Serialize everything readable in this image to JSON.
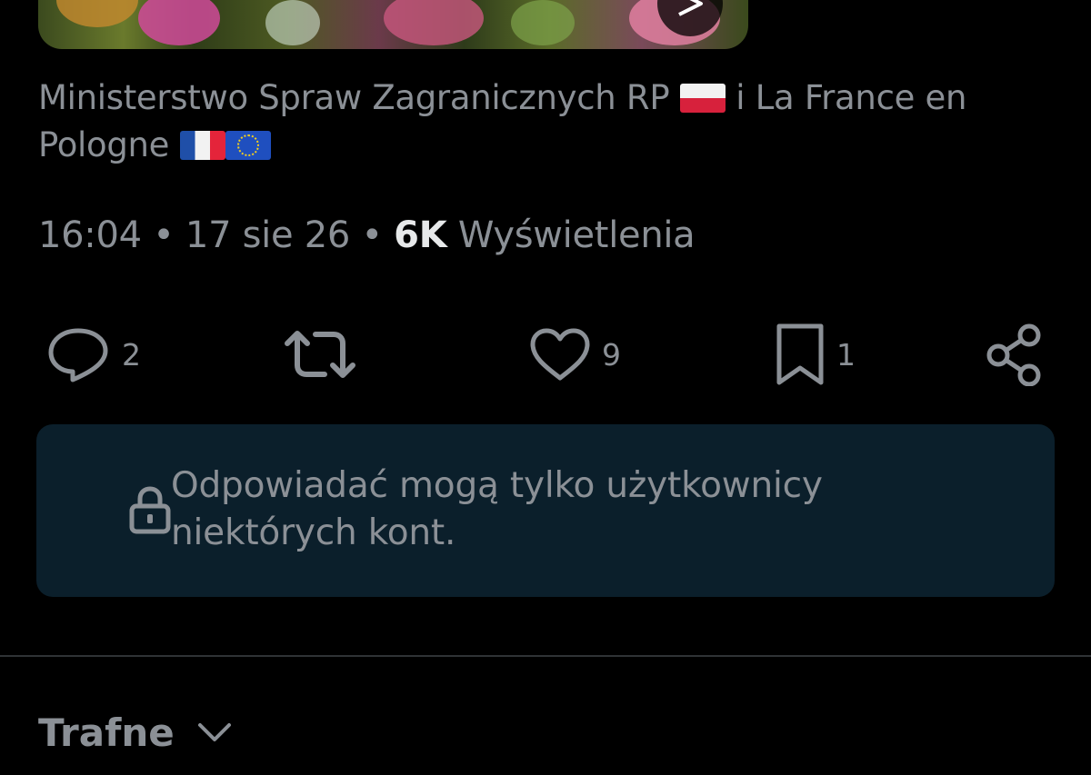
{
  "media": {
    "type": "video-thumbnail"
  },
  "credit": {
    "part1": "Ministerstwo Spraw Zagranicznych RP",
    "flag1": "flag-poland",
    "connector": "i La France en Pologne",
    "flag2": "flag-france",
    "flag3": "flag-eu"
  },
  "meta": {
    "time": "16:04",
    "separator1": "•",
    "date": "17 sie 26",
    "separator2": "•",
    "views_count": "6K",
    "views_label": "Wyświetlenia"
  },
  "actions": {
    "reply": {
      "icon": "reply-icon",
      "count": "2"
    },
    "repost": {
      "icon": "repost-icon",
      "count": ""
    },
    "like": {
      "icon": "heart-icon",
      "count": "9"
    },
    "bookmark": {
      "icon": "bookmark-icon",
      "count": "1"
    },
    "share": {
      "icon": "share-icon"
    }
  },
  "notice": {
    "icon": "lock-icon",
    "text": "Odpowiadać mogą tylko użytkownicy niektórych kont."
  },
  "sort": {
    "label": "Trafne",
    "icon": "chevron-down-icon"
  },
  "colors": {
    "background": "#000000",
    "text_secondary": "#8b9096",
    "text_primary": "#e7e9ea",
    "notice_bg": "#0b1f2b",
    "divider": "#2f3336"
  }
}
